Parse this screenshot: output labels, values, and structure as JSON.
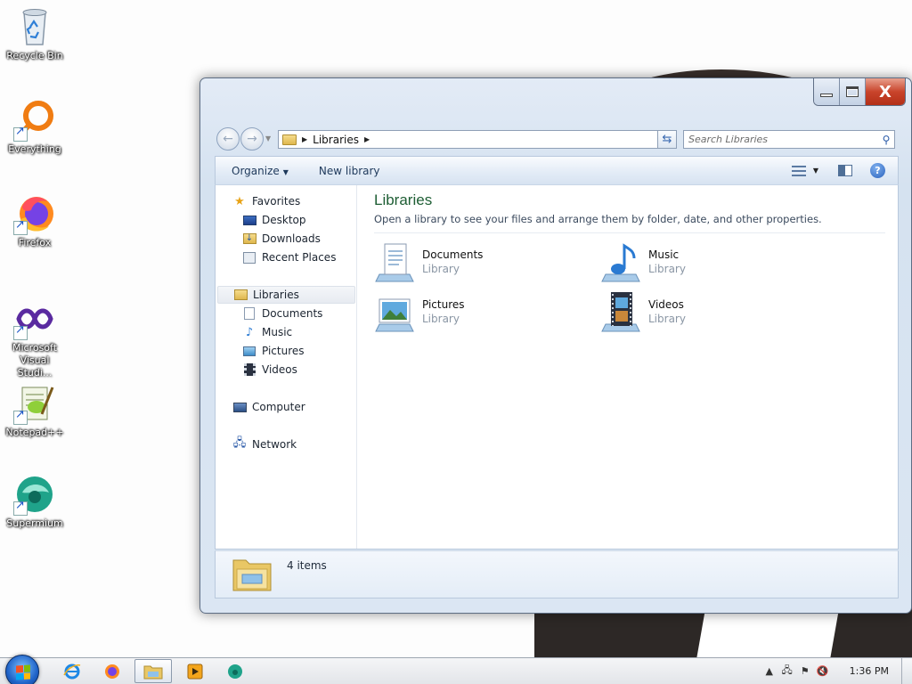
{
  "desktop": {
    "icons": [
      {
        "label": "Recycle Bin"
      },
      {
        "label": "Everything"
      },
      {
        "label": "Firefox"
      },
      {
        "label": "Microsoft Visual Studi..."
      },
      {
        "label": "Notepad++"
      },
      {
        "label": "Supermium"
      }
    ]
  },
  "window": {
    "caption": {
      "minimize": "",
      "maximize": "",
      "close": "X"
    },
    "address": {
      "crumb": "Libraries"
    },
    "search": {
      "placeholder": "Search Libraries"
    },
    "command_bar": {
      "organize": "Organize",
      "new_library": "New library",
      "help": "?"
    },
    "nav_pane": {
      "favorites": {
        "label": "Favorites",
        "items": [
          "Desktop",
          "Downloads",
          "Recent Places"
        ]
      },
      "libraries": {
        "label": "Libraries",
        "items": [
          "Documents",
          "Music",
          "Pictures",
          "Videos"
        ]
      },
      "computer": "Computer",
      "network": "Network"
    },
    "main": {
      "title": "Libraries",
      "subtitle": "Open a library to see your files and arrange them by folder, date, and other properties.",
      "libraries": [
        {
          "name": "Documents",
          "type": "Library",
          "icon": "documents-library-icon"
        },
        {
          "name": "Music",
          "type": "Library",
          "icon": "music-library-icon"
        },
        {
          "name": "Pictures",
          "type": "Library",
          "icon": "pictures-library-icon"
        },
        {
          "name": "Videos",
          "type": "Library",
          "icon": "videos-library-icon"
        }
      ]
    },
    "details": {
      "count": "4 items"
    }
  },
  "taskbar": {
    "pinned": [
      "internet-explorer-icon",
      "firefox-icon",
      "windows-explorer-icon",
      "media-player-icon",
      "supermium-icon"
    ],
    "clock": "1:36 PM"
  },
  "colors": {
    "title_green": "#1e5e34",
    "close_red": "#c9442b",
    "accent_blue": "#2b63bd"
  }
}
